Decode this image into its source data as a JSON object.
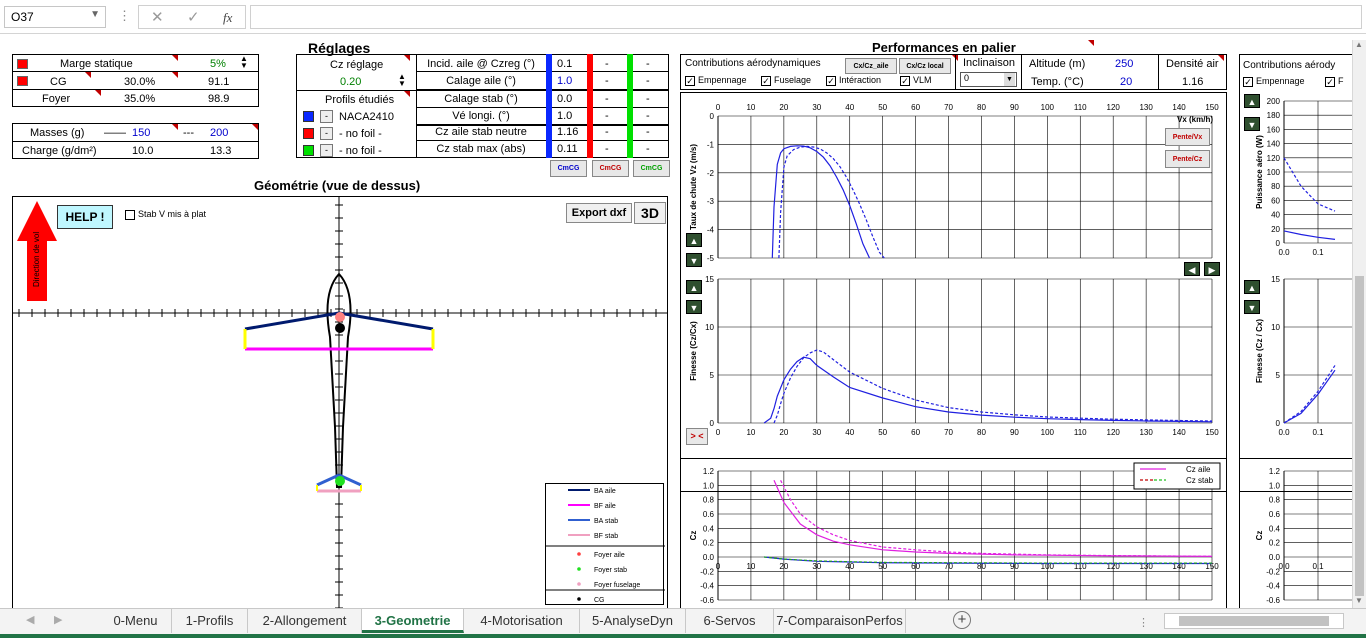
{
  "formula_bar": {
    "cell_ref": "O37",
    "cancel_icon": "✕",
    "confirm_icon": "✓",
    "fx": "fx",
    "formula": ""
  },
  "left_top": {
    "marge_statique_label": "Marge statique",
    "marge_statique_val": "5%",
    "cg_label": "CG",
    "cg_pct": "30.0%",
    "cg_mm": "91.1",
    "foyer_label": "Foyer",
    "foyer_pct": "35.0%",
    "foyer_mm": "98.9",
    "masses_label": "Masses (g)",
    "masses_v1": "150",
    "masses_v2": "200",
    "masses_solid": "——",
    "masses_dash": "---",
    "charge_label": "Charge (g/dm²)",
    "charge_v1": "10.0",
    "charge_v2": "13.3"
  },
  "reglages": {
    "title": "Réglages",
    "cz_reglage_label": "Cz réglage",
    "cz_reglage_val": "0.20",
    "profils_label": "Profils étudiés",
    "profiles": [
      {
        "name": "NACA2410",
        "color": "#0a28ff"
      },
      {
        "name": "- no foil -",
        "color": "#ff0000"
      },
      {
        "name": "- no foil -",
        "color": "#00e000"
      }
    ],
    "params": [
      {
        "label": "Incid. aile @ Czreg (°)",
        "v1": "0.1",
        "v2": "-",
        "v3": "-"
      },
      {
        "label": "Calage aile (°)",
        "v1": "1.0",
        "v2": "-",
        "v3": "-"
      },
      {
        "label": "Calage stab (°)",
        "v1": "0.0",
        "v2": "-",
        "v3": "-"
      },
      {
        "label": "Vé longi. (°)",
        "v1": "1.0",
        "v2": "-",
        "v3": "-"
      },
      {
        "label": "Cz aile stab neutre",
        "v1": "1.16",
        "v2": "-",
        "v3": "-"
      },
      {
        "label": "Cz stab max (abs)",
        "v1": "0.11",
        "v2": "-",
        "v3": "-"
      }
    ],
    "cmcg_buttons": [
      "CmCG",
      "CmCG",
      "CmCG"
    ]
  },
  "geometrie": {
    "title": "Géométrie (vue de dessus)",
    "help": "HELP !",
    "stab_v": "Stab V mis à plat",
    "export": "Export dxf",
    "btn3d": "3D",
    "direction": "Direction de vol",
    "legend": [
      "BA aile",
      "BF aile",
      "BA stab",
      "BF stab",
      "Foyer aile",
      "Foyer stab",
      "Foyer fuselage",
      "CG"
    ]
  },
  "perf": {
    "title": "Performances en palier",
    "contrib_label": "Contributions aérodynamiques",
    "checks": [
      "Empennage",
      "Fuselage",
      "Intéraction",
      "VLM"
    ],
    "btn_cx_aile": "Cx/Cz_aile",
    "btn_cx_local": "Cx/Cz local",
    "inclinaison_label": "Inclinaison",
    "inclinaison_val": "0",
    "altitude_label": "Altitude (m)",
    "altitude_val": "250",
    "temp_label": "Temp. (°C)",
    "temp_val": "20",
    "densite_label": "Densité air",
    "densite_val": "1.16",
    "pente_vx": "Pente/Vx",
    "pente_cz": "Pente/Cz",
    "reset_btn": "> <",
    "right_contrib_label": "Contributions aérody",
    "right_checks": [
      "Empennage",
      "F"
    ]
  },
  "chart_data": [
    {
      "type": "line",
      "title": "",
      "xlabel": "Vx (km/h)",
      "ylabel": "Taux de chute Vz (m/s)",
      "xlim": [
        0,
        150
      ],
      "ylim": [
        -5,
        0
      ],
      "grid": true,
      "xticks": [
        "0",
        "10",
        "20",
        "30",
        "40",
        "50",
        "60",
        "70",
        "80",
        "90",
        "100",
        "110",
        "120",
        "130",
        "140",
        "150"
      ],
      "yticks": [
        "0",
        "-1",
        "-2",
        "-3",
        "-4",
        "-5"
      ],
      "series": [
        {
          "style": "solid",
          "color": "#2020e0",
          "x": [
            16.5,
            17,
            18,
            19,
            20,
            22,
            24,
            26,
            28,
            30,
            32,
            34,
            36,
            38,
            40,
            42,
            44,
            46
          ],
          "y": [
            -5,
            -3.2,
            -1.7,
            -1.3,
            -1.15,
            -1.07,
            -1.05,
            -1.06,
            -1.12,
            -1.25,
            -1.45,
            -1.75,
            -2.15,
            -2.6,
            -3.15,
            -3.8,
            -4.5,
            -5
          ]
        },
        {
          "style": "dashed",
          "color": "#2020e0",
          "x": [
            18.5,
            19,
            20,
            21,
            23,
            25,
            27,
            29,
            31,
            33,
            35,
            37,
            39,
            41,
            43,
            45,
            47,
            49,
            50.5
          ],
          "y": [
            -5,
            -3.4,
            -1.8,
            -1.4,
            -1.18,
            -1.1,
            -1.07,
            -1.09,
            -1.16,
            -1.3,
            -1.5,
            -1.78,
            -2.15,
            -2.6,
            -3.1,
            -3.65,
            -4.25,
            -4.8,
            -5
          ]
        }
      ]
    },
    {
      "type": "line",
      "title": "",
      "xlabel": "",
      "ylabel": "Finesse (Cz/Cx)",
      "xlim": [
        0,
        150
      ],
      "ylim": [
        0,
        15
      ],
      "grid": true,
      "xticks": [
        "0",
        "10",
        "20",
        "30",
        "40",
        "50",
        "60",
        "70",
        "80",
        "90",
        "100",
        "110",
        "120",
        "130",
        "140",
        "150"
      ],
      "yticks": [
        "0",
        "5",
        "10",
        "15"
      ],
      "series": [
        {
          "style": "solid",
          "color": "#2020e0",
          "x": [
            14,
            16,
            17,
            18,
            20,
            22,
            24,
            26,
            28,
            30,
            35,
            40,
            50,
            60,
            70,
            80,
            90,
            100,
            110,
            120,
            130,
            140,
            150
          ],
          "y": [
            0,
            0.5,
            1.5,
            2.8,
            4.5,
            5.6,
            6.4,
            6.85,
            6.7,
            6,
            4.8,
            3.7,
            2.6,
            1.7,
            1.15,
            0.82,
            0.6,
            0.45,
            0.35,
            0.27,
            0.21,
            0.17,
            0.13
          ]
        },
        {
          "style": "dashed",
          "color": "#2020e0",
          "x": [
            17,
            18,
            19,
            20,
            22,
            24,
            26,
            28,
            30,
            32,
            35,
            40,
            50,
            60,
            70,
            80,
            90,
            100,
            110,
            120,
            130,
            140,
            150
          ],
          "y": [
            0,
            0.8,
            2,
            3.1,
            4.7,
            5.9,
            6.8,
            7.3,
            7.6,
            7.4,
            6.6,
            5.3,
            3.6,
            2.4,
            1.6,
            1.15,
            0.85,
            0.63,
            0.5,
            0.4,
            0.32,
            0.26,
            0.21
          ]
        }
      ]
    },
    {
      "type": "line",
      "title": "",
      "xlabel": "",
      "ylabel": "Cz",
      "xlim": [
        0,
        150
      ],
      "ylim": [
        -0.6,
        1.2
      ],
      "grid": true,
      "xticks": [
        "0",
        "10",
        "20",
        "30",
        "40",
        "50",
        "60",
        "70",
        "80",
        "90",
        "100",
        "110",
        "120",
        "130",
        "140",
        "150"
      ],
      "yticks": [
        "1.2",
        "1.0",
        "0.8",
        "0.6",
        "0.4",
        "0.2",
        "0.0",
        "-0.2",
        "-0.4",
        "-0.6"
      ],
      "legend": [
        "Cz aile",
        "Cz stab"
      ],
      "series": [
        {
          "name": "Cz aile",
          "style": "solid",
          "color": "#e020e0",
          "x": [
            17,
            20,
            25,
            30,
            35,
            40,
            50,
            60,
            70,
            80,
            90,
            100,
            120,
            150
          ],
          "y": [
            1.07,
            0.76,
            0.46,
            0.31,
            0.22,
            0.17,
            0.1,
            0.07,
            0.05,
            0.04,
            0.03,
            0.025,
            0.015,
            0.01
          ]
        },
        {
          "name": "Cz aile",
          "style": "dashed",
          "color": "#e020e0",
          "x": [
            19,
            22,
            25,
            30,
            35,
            40,
            50,
            60,
            70,
            80,
            90,
            100,
            120,
            150
          ],
          "y": [
            1.07,
            0.8,
            0.6,
            0.42,
            0.31,
            0.23,
            0.14,
            0.1,
            0.07,
            0.05,
            0.04,
            0.03,
            0.02,
            0.01
          ]
        },
        {
          "name": "Cz stab",
          "style": "solid",
          "color": "#2020e0",
          "x": [
            14,
            20,
            30,
            40,
            50,
            70,
            100,
            150
          ],
          "y": [
            0,
            -0.03,
            -0.06,
            -0.07,
            -0.08,
            -0.085,
            -0.09,
            -0.09
          ]
        },
        {
          "name": "Cz stab",
          "style": "dashed",
          "color": "#20a020",
          "x": [
            14,
            20,
            30,
            40,
            50,
            70,
            100,
            150
          ],
          "y": [
            0,
            -0.03,
            -0.055,
            -0.065,
            -0.075,
            -0.08,
            -0.085,
            -0.085
          ]
        }
      ]
    },
    {
      "type": "line",
      "title": "",
      "xlabel": "",
      "ylabel": "Puissance aéro (W)",
      "xlim": [
        0,
        0.2
      ],
      "ylim": [
        0,
        200
      ],
      "grid": true,
      "xticks": [
        "0.0",
        "0.1"
      ],
      "yticks": [
        "200",
        "180",
        "160",
        "140",
        "120",
        "100",
        "80",
        "60",
        "40",
        "20",
        "0"
      ],
      "series": [
        {
          "style": "solid",
          "color": "#2020e0",
          "x": [
            0,
            0.05,
            0.1,
            0.15
          ],
          "y": [
            17,
            12,
            8,
            5
          ]
        },
        {
          "style": "dashed",
          "color": "#2020e0",
          "x": [
            0,
            0.05,
            0.1,
            0.15
          ],
          "y": [
            120,
            80,
            55,
            45
          ]
        }
      ]
    },
    {
      "type": "line",
      "title": "",
      "xlabel": "",
      "ylabel": "Finesse (Cz / Cx)",
      "xlim": [
        0,
        0.2
      ],
      "ylim": [
        0,
        15
      ],
      "grid": true,
      "xticks": [
        "0.0",
        "0.1"
      ],
      "yticks": [
        "15",
        "10",
        "5",
        "0"
      ],
      "series": [
        {
          "style": "solid",
          "color": "#2020e0",
          "x": [
            0,
            0.05,
            0.1,
            0.15
          ],
          "y": [
            0,
            1,
            3,
            5.5
          ]
        },
        {
          "style": "dashed",
          "color": "#2020e0",
          "x": [
            0,
            0.05,
            0.1,
            0.15
          ],
          "y": [
            0,
            1.2,
            3.3,
            6
          ]
        }
      ]
    },
    {
      "type": "line",
      "title": "",
      "xlabel": "",
      "ylabel": "Cz",
      "xlim": [
        0,
        0.2
      ],
      "ylim": [
        -0.6,
        1.2
      ],
      "grid": true,
      "xticks": [
        "0.0",
        "0.1"
      ],
      "yticks": [
        "1.2",
        "1.0",
        "0.8",
        "0.6",
        "0.4",
        "0.2",
        "0.0",
        "-0.2",
        "-0.4",
        "-0.6"
      ],
      "series": []
    }
  ],
  "tabs": [
    "0-Menu",
    "1-Profils",
    "2-Allongement",
    "3-Geometrie",
    "4-Motorisation",
    "5-AnalyseDyn",
    "6-Servos",
    "7-ComparaisonPerfos"
  ],
  "active_tab": "3-Geometrie",
  "add_sheet": "+"
}
